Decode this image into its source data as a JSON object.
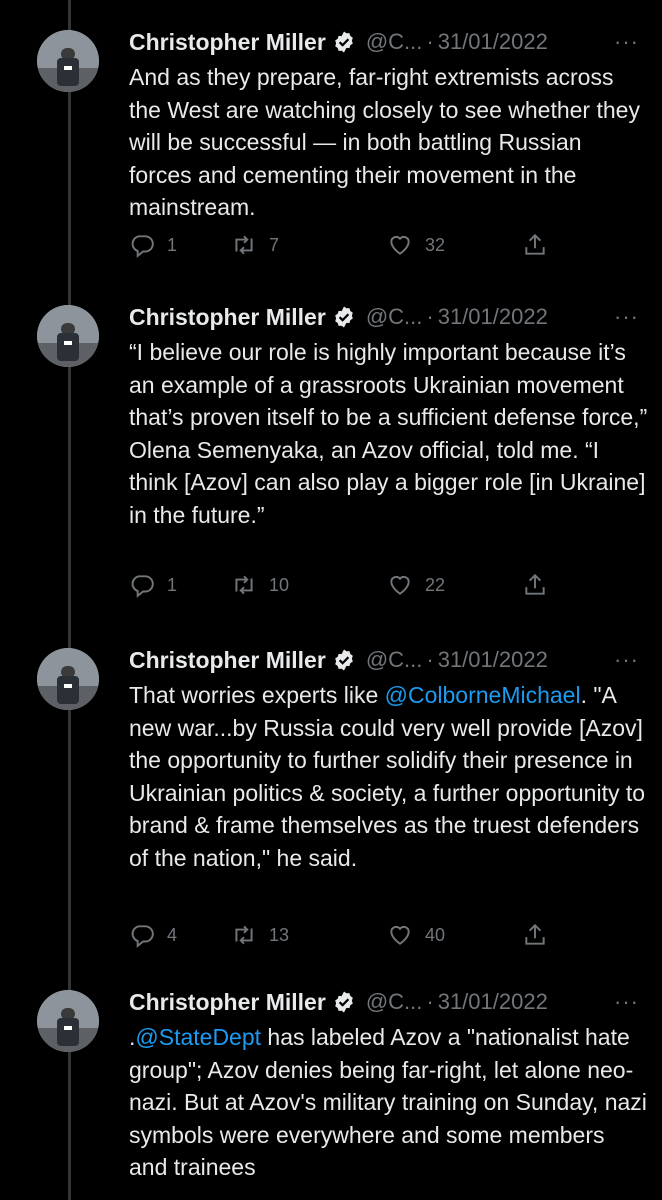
{
  "tweets": [
    {
      "name": "Christopher Miller",
      "handle": "@C...",
      "dot": "·",
      "date": "31/01/2022",
      "more": "···",
      "text": "And as they prepare, far-right extremists across the West are watching closely to see whether they will be successful — in both battling Russian forces and cementing their movement in the mainstream.",
      "replies": "1",
      "retweets": "7",
      "likes": "32"
    },
    {
      "name": "Christopher Miller",
      "handle": "@C...",
      "dot": "·",
      "date": "31/01/2022",
      "more": "···",
      "text": "“I believe our role is highly important because it’s an example of a grassroots Ukrainian movement that’s proven itself to be a sufficient defense force,” Olena Semenyaka, an Azov official, told me. “I think [Azov] can also play a bigger role [in Ukraine] in the future.”",
      "replies": "1",
      "retweets": "10",
      "likes": "22"
    },
    {
      "name": "Christopher Miller",
      "handle": "@C...",
      "dot": "·",
      "date": "31/01/2022",
      "more": "···",
      "text_before": "That worries experts like ",
      "mention": "@ColborneMichael",
      "text_after": ". \"A new war...by Russia could very well provide [Azov] the opportunity to further solidify their presence in Ukrainian politics & society, a further opportunity to brand & frame themselves as the truest defenders of the nation,\" he said.",
      "replies": "4",
      "retweets": "13",
      "likes": "40"
    },
    {
      "name": "Christopher Miller",
      "handle": "@C...",
      "dot": "·",
      "date": "31/01/2022",
      "more": "···",
      "text_before": ".",
      "mention": "@StateDept",
      "text_after": " has labeled Azov a \"nationalist hate group\"; Azov denies being far-right, let alone neo-nazi. But at Azov's military training on Sunday, nazi symbols were everywhere and some members and trainees"
    }
  ],
  "icons": {
    "reply": "reply-icon",
    "retweet": "retweet-icon",
    "like": "heart-icon",
    "share": "share-icon",
    "verified": "verified-badge-icon"
  },
  "colors": {
    "background": "#000000",
    "text": "#e7e9ea",
    "secondary": "#71767b",
    "link": "#1d9bf0",
    "thread_line": "#333639"
  }
}
